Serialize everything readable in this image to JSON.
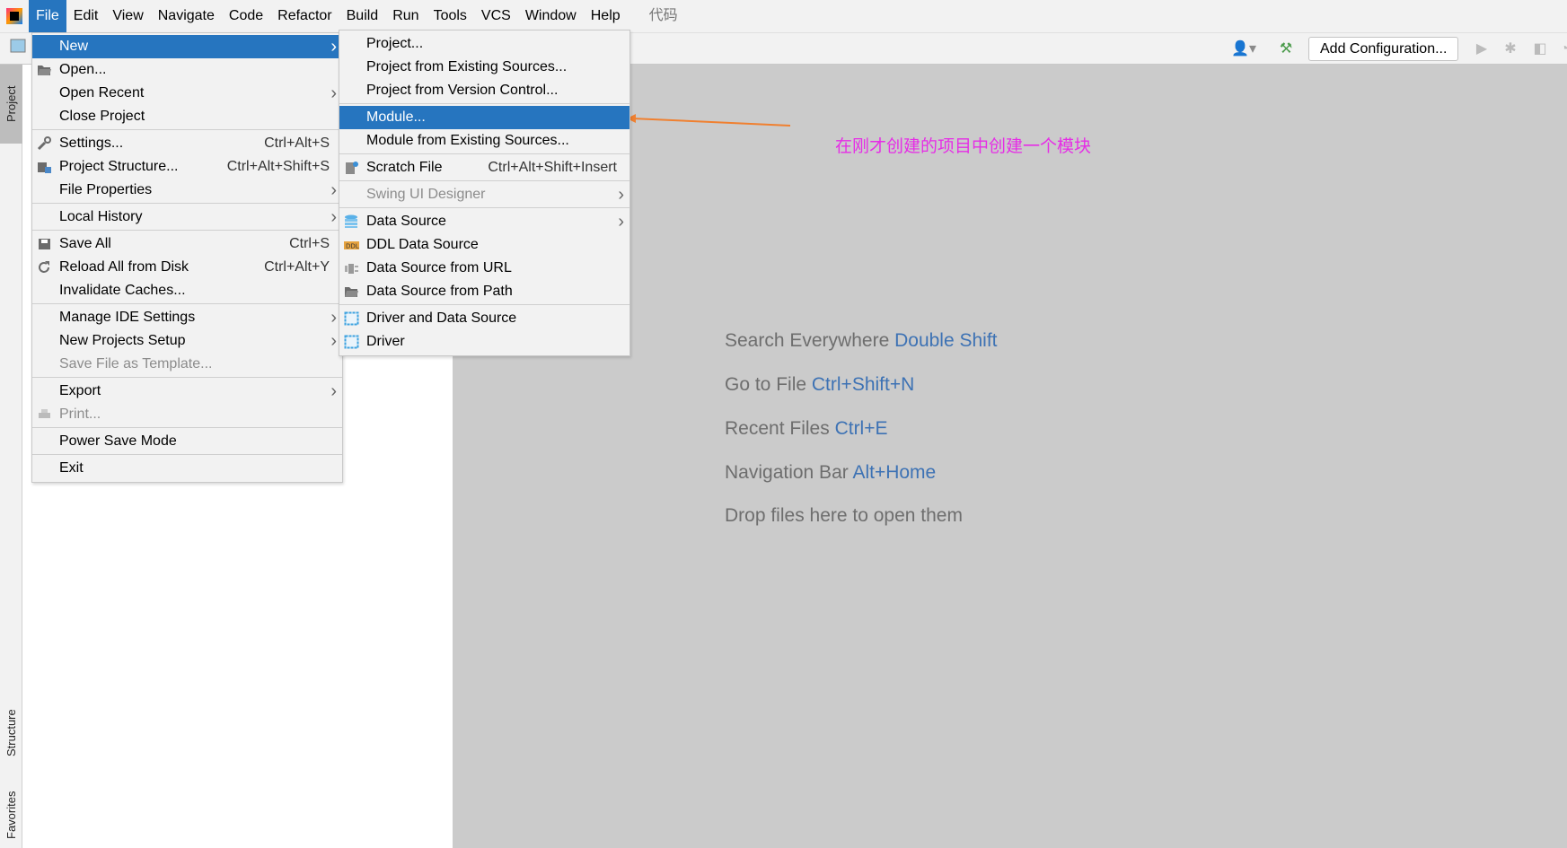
{
  "menubar": {
    "items": [
      "File",
      "Edit",
      "View",
      "Navigate",
      "Code",
      "Refactor",
      "Build",
      "Run",
      "Tools",
      "VCS",
      "Window",
      "Help"
    ],
    "extra": "代码",
    "active": "File"
  },
  "toolbar": {
    "add_configuration": "Add Configuration..."
  },
  "side_tabs": {
    "project": "Project",
    "structure": "Structure",
    "favorites": "Favorites"
  },
  "file_menu": [
    {
      "label": "New",
      "arrow": true,
      "selected": true
    },
    {
      "label": "Open...",
      "icon": "folder-icon"
    },
    {
      "label": "Open Recent",
      "arrow": true
    },
    {
      "label": "Close Project"
    },
    {
      "sep": true
    },
    {
      "label": "Settings...",
      "shortcut": "Ctrl+Alt+S",
      "icon": "wrench-icon"
    },
    {
      "label": "Project Structure...",
      "shortcut": "Ctrl+Alt+Shift+S",
      "icon": "project-structure-icon"
    },
    {
      "label": "File Properties",
      "arrow": true
    },
    {
      "sep": true
    },
    {
      "label": "Local History",
      "arrow": true
    },
    {
      "sep": true
    },
    {
      "label": "Save All",
      "shortcut": "Ctrl+S",
      "icon": "save-icon"
    },
    {
      "label": "Reload All from Disk",
      "shortcut": "Ctrl+Alt+Y",
      "icon": "reload-icon"
    },
    {
      "label": "Invalidate Caches..."
    },
    {
      "sep": true
    },
    {
      "label": "Manage IDE Settings",
      "arrow": true
    },
    {
      "label": "New Projects Setup",
      "arrow": true
    },
    {
      "label": "Save File as Template...",
      "disabled": true
    },
    {
      "sep": true
    },
    {
      "label": "Export",
      "arrow": true
    },
    {
      "label": "Print...",
      "disabled": true,
      "icon": "print-icon"
    },
    {
      "sep": true
    },
    {
      "label": "Power Save Mode"
    },
    {
      "sep": true
    },
    {
      "label": "Exit"
    }
  ],
  "new_submenu": [
    {
      "label": "Project..."
    },
    {
      "label": "Project from Existing Sources..."
    },
    {
      "label": "Project from Version Control..."
    },
    {
      "sep": true
    },
    {
      "label": "Module...",
      "selected": true
    },
    {
      "label": "Module from Existing Sources..."
    },
    {
      "sep": true
    },
    {
      "label": "Scratch File",
      "shortcut": "Ctrl+Alt+Shift+Insert",
      "icon": "scratch-file-icon"
    },
    {
      "sep": true
    },
    {
      "label": "Swing UI Designer",
      "arrow": true,
      "disabled": true
    },
    {
      "sep": true
    },
    {
      "label": "Data Source",
      "arrow": true,
      "icon": "database-icon"
    },
    {
      "label": "DDL Data Source",
      "icon": "ddl-icon"
    },
    {
      "label": "Data Source from URL",
      "icon": "url-icon"
    },
    {
      "label": "Data Source from Path",
      "icon": "folder-icon"
    },
    {
      "sep": true
    },
    {
      "label": "Driver and Data Source",
      "icon": "driver-icon"
    },
    {
      "label": "Driver",
      "icon": "driver-icon"
    }
  ],
  "editor_hints": [
    {
      "text": "Search Everywhere",
      "key": "Double Shift"
    },
    {
      "text": "Go to File",
      "key": "Ctrl+Shift+N"
    },
    {
      "text": "Recent Files",
      "key": "Ctrl+E"
    },
    {
      "text": "Navigation Bar",
      "key": "Alt+Home"
    },
    {
      "text": "Drop files here to open them",
      "key": ""
    }
  ],
  "annotation": {
    "text": "在刚才创建的项目中创建一个模块",
    "color": "#e62de6",
    "arrow_color": "#f08030"
  },
  "colors": {
    "selection": "#2675bf",
    "hint_key": "#3d72b4"
  }
}
